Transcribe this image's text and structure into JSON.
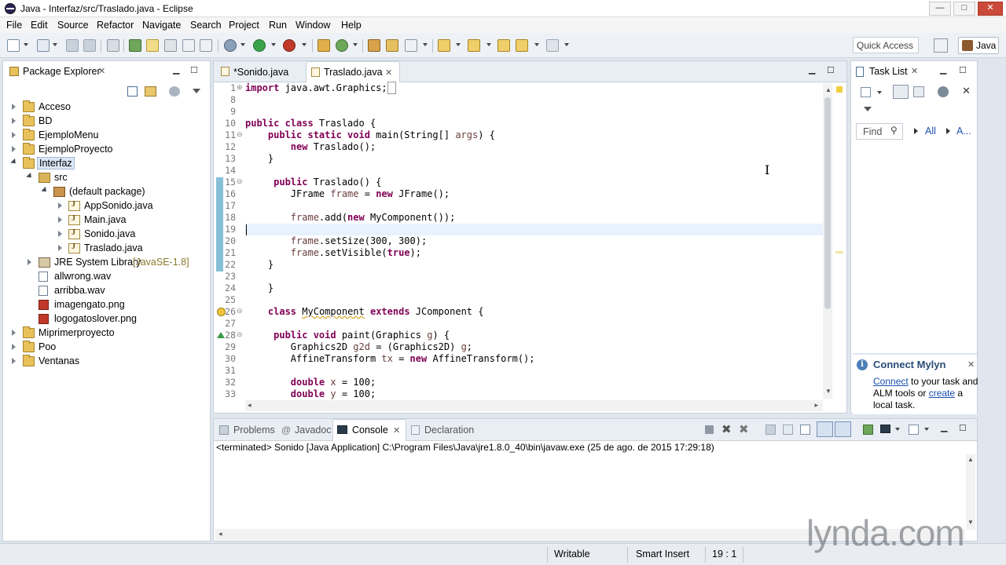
{
  "window": {
    "title": "Java - Interfaz/src/Traslado.java - Eclipse",
    "controls": {
      "minimize": "—",
      "maximize": "□",
      "close": "✕"
    }
  },
  "menu": [
    "File",
    "Edit",
    "Source",
    "Refactor",
    "Navigate",
    "Search",
    "Project",
    "Run",
    "Window",
    "Help"
  ],
  "toolbar": {
    "quick_access": "Quick Access",
    "perspective": "Java"
  },
  "package_explorer": {
    "title": "Package Explorer",
    "tree": [
      {
        "label": "Acceso",
        "icon": "project-icon",
        "expanded": false
      },
      {
        "label": "BD",
        "icon": "project-icon",
        "expanded": false
      },
      {
        "label": "EjemploMenu",
        "icon": "project-icon",
        "expanded": false
      },
      {
        "label": "EjemploProyecto",
        "icon": "project-icon",
        "expanded": false
      },
      {
        "label": "Interfaz",
        "icon": "project-icon",
        "expanded": true
      },
      {
        "label": "src",
        "icon": "source-folder-icon",
        "expanded": true
      },
      {
        "label": "(default package)",
        "icon": "package-icon",
        "expanded": true
      },
      {
        "label": "AppSonido.java",
        "icon": "java-file-icon",
        "expanded": false
      },
      {
        "label": "Main.java",
        "icon": "java-file-icon",
        "expanded": false
      },
      {
        "label": "Sonido.java",
        "icon": "java-file-icon",
        "expanded": false
      },
      {
        "label": "Traslado.java",
        "icon": "java-file-icon",
        "expanded": false
      },
      {
        "label": "JRE System Library",
        "suffix": "[JavaSE-1.8]",
        "icon": "library-icon",
        "expanded": false
      },
      {
        "label": "allwrong.wav",
        "icon": "file-icon"
      },
      {
        "label": "arribba.wav",
        "icon": "file-icon"
      },
      {
        "label": "imagengato.png",
        "icon": "image-file-icon"
      },
      {
        "label": "logogatoslover.png",
        "icon": "image-file-icon"
      },
      {
        "label": "Miprimerproyecto",
        "icon": "project-icon",
        "expanded": false
      },
      {
        "label": "Poo",
        "icon": "project-icon",
        "expanded": false
      },
      {
        "label": "Ventanas",
        "icon": "project-icon",
        "expanded": false
      }
    ]
  },
  "editor": {
    "tabs": [
      {
        "label": "*Sonido.java",
        "active": false
      },
      {
        "label": "Traslado.java",
        "active": true
      }
    ],
    "lines": [
      {
        "n": "1",
        "text": "import java.awt.Graphics;[]"
      },
      {
        "n": "8",
        "text": ""
      },
      {
        "n": "9",
        "text": ""
      },
      {
        "n": "10",
        "text": "public class Traslado {"
      },
      {
        "n": "11",
        "text": "    public static void main(String[] args) {"
      },
      {
        "n": "12",
        "text": "        new Traslado();"
      },
      {
        "n": "13",
        "text": "    }"
      },
      {
        "n": "14",
        "text": ""
      },
      {
        "n": "15",
        "text": "    public Traslado() {"
      },
      {
        "n": "16",
        "text": "        JFrame frame = new JFrame();"
      },
      {
        "n": "17",
        "text": ""
      },
      {
        "n": "18",
        "text": "        frame.add(new MyComponent());"
      },
      {
        "n": "19",
        "text": ""
      },
      {
        "n": "20",
        "text": "        frame.setSize(300, 300);"
      },
      {
        "n": "21",
        "text": "        frame.setVisible(true);"
      },
      {
        "n": "22",
        "text": "    }"
      },
      {
        "n": "23",
        "text": ""
      },
      {
        "n": "24",
        "text": "    }"
      },
      {
        "n": "25",
        "text": ""
      },
      {
        "n": "26",
        "text": "    class MyComponent extends JComponent {"
      },
      {
        "n": "27",
        "text": ""
      },
      {
        "n": "28",
        "text": "        public void paint(Graphics g) {"
      },
      {
        "n": "29",
        "text": "            Graphics2D g2d = (Graphics2D) g;"
      },
      {
        "n": "30",
        "text": "            AffineTransform tx = new AffineTransform();"
      },
      {
        "n": "31",
        "text": ""
      },
      {
        "n": "32",
        "text": "            double x = 100;"
      },
      {
        "n": "33",
        "text": "            double y = 100;"
      }
    ]
  },
  "task_list": {
    "title": "Task List",
    "find_placeholder": "Find",
    "all_label": "All",
    "activate_label": "A...",
    "mylyn": {
      "title": "Connect Mylyn",
      "link1": "Connect",
      "text1": " to your task and",
      "text2": "ALM tools or ",
      "link2": "create",
      "text3": " a",
      "text4": "local task."
    }
  },
  "bottom_panel": {
    "tabs": [
      {
        "label": "Problems",
        "active": false
      },
      {
        "label": "Javadoc",
        "active": false
      },
      {
        "label": "Console",
        "active": true
      },
      {
        "label": "Declaration",
        "active": false
      }
    ],
    "console_header": "<terminated> Sonido [Java Application] C:\\Program Files\\Java\\jre1.8.0_40\\bin\\javaw.exe (25 de ago. de 2015 17:29:18)"
  },
  "status": {
    "writable": "Writable",
    "insert_mode": "Smart Insert",
    "position": "19 : 1"
  },
  "watermark": "lynda.com",
  "colors": {
    "keyword": "#7f0055",
    "variable": "#6a3e3e",
    "link": "#1a4fb0",
    "current_line": "#e8f2fe"
  }
}
